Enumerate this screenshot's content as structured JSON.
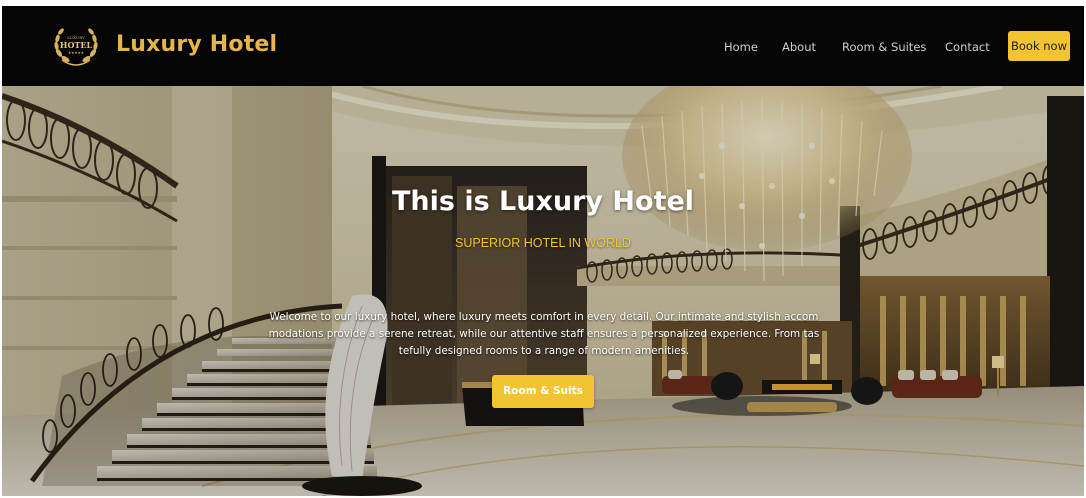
{
  "navbar": {
    "logo": {
      "icon": "laurel-crest-icon",
      "crest_text_top": "LUXURY",
      "crest_text_main": "HOTEL",
      "crest_stars": "★★★★★"
    },
    "brand_name": "Luxury Hotel",
    "links": [
      {
        "label": "Home"
      },
      {
        "label": "About"
      },
      {
        "label": "Room & Suites"
      },
      {
        "label": "Contact"
      }
    ],
    "book_button_label": "Book now"
  },
  "hero": {
    "title": "This is Luxury Hotel",
    "subtitle": "SUPERIOR HOTEL IN WORLD",
    "description": "Welcome to our luxury hotel, where luxury meets comfort in every detail. Our intimate and stylish accommodations provide a serene retreat, while our attentive staff ensures a personalized experience. From tastefully designed rooms to a range of modern amenities.",
    "cta_label": "Room & Suits"
  },
  "colors": {
    "navbar_bg": "#050505",
    "brand": "#e6b54a",
    "accent": "#f2c530",
    "nav_link": "#cfcfcf"
  }
}
